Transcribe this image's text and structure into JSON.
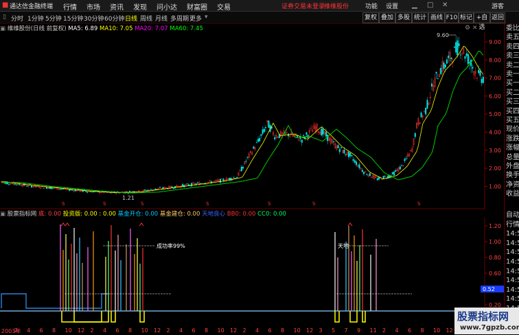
{
  "app": {
    "title": "通达信金融终端",
    "menu": [
      "行情",
      "市场",
      "资讯",
      "发现",
      "问小达",
      "财富圈",
      "交易"
    ],
    "notice": "证券交易未登录",
    "stock_badge": "维维股份",
    "actions": [
      "功能",
      "设置",
      "游客"
    ]
  },
  "tabs": [
    "分时",
    "1分钟",
    "5分钟",
    "15分钟",
    "30分钟",
    "60分钟",
    "日线",
    "周线",
    "月线",
    "多周期",
    "更多"
  ],
  "active_tab": "日线",
  "toolbar": [
    "复权",
    "叠加",
    "多股",
    "统计",
    "画线",
    "F10",
    "标记",
    "+自选",
    "返回"
  ],
  "main_chart": {
    "title": "维维股份(日线 前复权)",
    "ma5": "MA5: 6.89",
    "ma10": "MA10: 7.05",
    "ma20": "MA20: 7.07",
    "ma60": "MA60: 7.45",
    "high_label": "9.60",
    "low_label": "1.21",
    "y_ticks": [
      "9.00",
      "8.00",
      "7.00",
      "6.00",
      "5.00",
      "4.00",
      "3.00",
      "2.00",
      "1.00"
    ],
    "colors": {
      "ma5": "#ffffff",
      "ma10": "#ffff00",
      "ma20": "#ff00ff",
      "ma60": "#00ff00",
      "up": "#ff3333",
      "down": "#00ffff"
    }
  },
  "side_panel": [
    "委比",
    "卖五",
    "卖四",
    "卖三",
    "卖二",
    "卖一",
    "买一",
    "买二",
    "买三",
    "买四",
    "买五",
    "现价",
    "涨跌",
    "涨幅",
    "总量",
    "外盘",
    "换手",
    "净资",
    "收益"
  ],
  "side_panel2": [
    "自动",
    "行情",
    "14:5",
    "14:5",
    "14:5",
    "14:5",
    "14:5",
    "14:5",
    "14:5",
    "14:5",
    "14:5",
    "14:5"
  ],
  "indicator": {
    "name": "股票指标网",
    "items": [
      {
        "label": "底",
        "value": "0.00"
      },
      {
        "label": "投资版",
        "value": "0.00 : 0.00"
      },
      {
        "label": "基金开仓",
        "value": "0.00"
      },
      {
        "label": "基金建仓",
        "value": "0.00"
      },
      {
        "label": "天地良心",
        "value": ""
      },
      {
        "label": "BB0",
        "value": "0.00"
      },
      {
        "label": "CC0",
        "value": "0.00"
      }
    ],
    "y_ticks": [
      "1.20",
      "1.00",
      "0.80",
      "0.60",
      "0.40",
      "0.20"
    ],
    "current_value": "0.52",
    "annotations": [
      "成功率99%",
      "天地"
    ]
  },
  "x_axis": [
    "2003年",
    "2",
    "4",
    "6",
    "8",
    "10",
    "12",
    "2",
    "4",
    "6",
    "8",
    "10",
    "12",
    "2",
    "4",
    "6",
    "8",
    "10",
    "12",
    "2",
    "4",
    "6",
    "8",
    "10",
    "12",
    "3",
    "5",
    "7",
    "9",
    "11",
    "2",
    "4",
    "6",
    "8",
    "10",
    "12"
  ],
  "watermark": {
    "title": "股票指标网",
    "url": "www.7gpzb.com"
  }
}
